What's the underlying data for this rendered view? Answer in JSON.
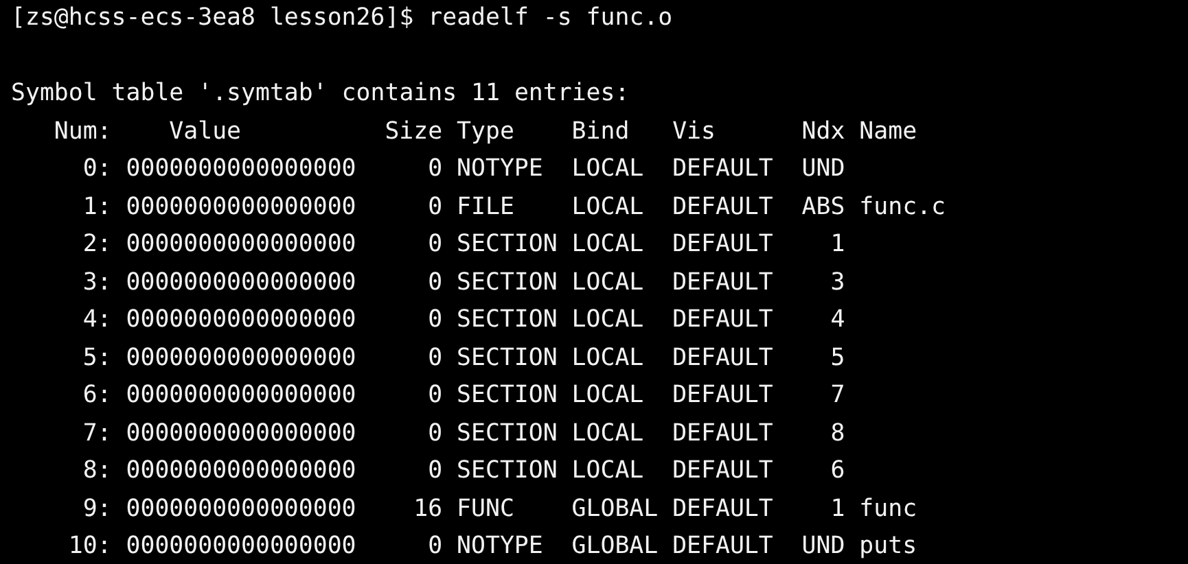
{
  "terminal": {
    "prompt": "[zs@hcss-ecs-3ea8 lesson26]$",
    "command": "readelf -s func.o",
    "heading": "Symbol table '.symtab' contains 11 entries:",
    "columns": [
      "Num:",
      "Value",
      "Size",
      "Type",
      "Bind",
      "Vis",
      "Ndx",
      "Name"
    ],
    "rows": [
      [
        "0:",
        "0000000000000000",
        "0",
        "NOTYPE",
        "LOCAL",
        "DEFAULT",
        "UND",
        ""
      ],
      [
        "1:",
        "0000000000000000",
        "0",
        "FILE",
        "LOCAL",
        "DEFAULT",
        "ABS",
        "func.c"
      ],
      [
        "2:",
        "0000000000000000",
        "0",
        "SECTION",
        "LOCAL",
        "DEFAULT",
        "1",
        ""
      ],
      [
        "3:",
        "0000000000000000",
        "0",
        "SECTION",
        "LOCAL",
        "DEFAULT",
        "3",
        ""
      ],
      [
        "4:",
        "0000000000000000",
        "0",
        "SECTION",
        "LOCAL",
        "DEFAULT",
        "4",
        ""
      ],
      [
        "5:",
        "0000000000000000",
        "0",
        "SECTION",
        "LOCAL",
        "DEFAULT",
        "5",
        ""
      ],
      [
        "6:",
        "0000000000000000",
        "0",
        "SECTION",
        "LOCAL",
        "DEFAULT",
        "7",
        ""
      ],
      [
        "7:",
        "0000000000000000",
        "0",
        "SECTION",
        "LOCAL",
        "DEFAULT",
        "8",
        ""
      ],
      [
        "8:",
        "0000000000000000",
        "0",
        "SECTION",
        "LOCAL",
        "DEFAULT",
        "6",
        ""
      ],
      [
        "9:",
        "0000000000000000",
        "16",
        "FUNC",
        "GLOBAL",
        "DEFAULT",
        "1",
        "func"
      ],
      [
        "10:",
        "0000000000000000",
        "0",
        "NOTYPE",
        "GLOBAL",
        "DEFAULT",
        "UND",
        "puts"
      ]
    ]
  }
}
